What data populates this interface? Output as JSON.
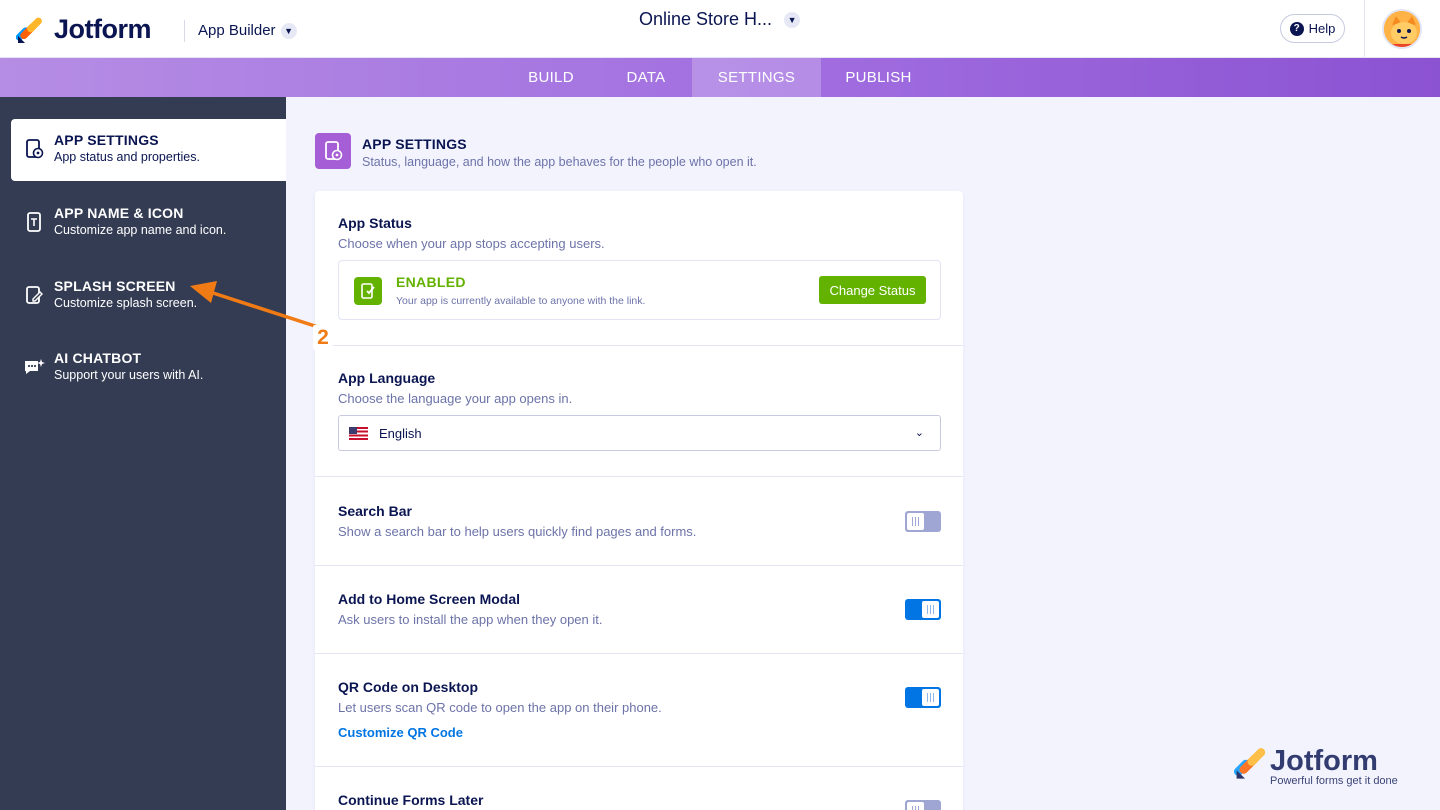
{
  "header": {
    "logo_text": "Jotform",
    "app_builder_label": "App Builder",
    "form_title": "Online Store H...",
    "help_label": "Help"
  },
  "nav": {
    "tabs": [
      {
        "label": "BUILD",
        "active": false
      },
      {
        "label": "DATA",
        "active": false
      },
      {
        "label": "SETTINGS",
        "active": true
      },
      {
        "label": "PUBLISH",
        "active": false
      }
    ]
  },
  "sidebar": {
    "items": [
      {
        "title": "APP SETTINGS",
        "subtitle": "App status and properties.",
        "icon": "settings-doc-icon",
        "active": true
      },
      {
        "title": "APP NAME & ICON",
        "subtitle": "Customize app name and icon.",
        "icon": "phone-text-icon",
        "active": false
      },
      {
        "title": "SPLASH SCREEN",
        "subtitle": "Customize splash screen.",
        "icon": "pencil-doc-icon",
        "active": false
      },
      {
        "title": "AI CHATBOT",
        "subtitle": "Support your users with AI.",
        "icon": "chat-sparkle-icon",
        "active": false
      }
    ]
  },
  "main": {
    "title": "APP SETTINGS",
    "subtitle": "Status, language, and how the app behaves for the people who open it.",
    "app_status": {
      "title": "App Status",
      "desc": "Choose when your app stops accepting users.",
      "status_label": "ENABLED",
      "status_desc": "Your app is currently available to anyone with the link.",
      "button_label": "Change Status"
    },
    "app_language": {
      "title": "App Language",
      "desc": "Choose the language your app opens in.",
      "selected": "English"
    },
    "search_bar": {
      "title": "Search Bar",
      "desc": "Show a search bar to help users quickly find pages and forms.",
      "enabled": false
    },
    "home_screen": {
      "title": "Add to Home Screen Modal",
      "desc": "Ask users to install the app when they open it.",
      "enabled": true
    },
    "qr_code": {
      "title": "QR Code on Desktop",
      "desc": "Let users scan QR code to open the app on their phone.",
      "link": "Customize QR Code",
      "enabled": true
    },
    "continue_forms": {
      "title": "Continue Forms Later",
      "enabled": false
    }
  },
  "annotation": {
    "step": "2",
    "color": "#f07b14"
  },
  "watermark": {
    "text": "Jotform",
    "tagline": "Powerful forms get it done"
  },
  "colors": {
    "brand_navy": "#0a1551",
    "success_green": "#64b200",
    "toggle_blue": "#0075e3",
    "sidebar_bg": "#343c54",
    "nav_purple": "#a16ee0"
  }
}
